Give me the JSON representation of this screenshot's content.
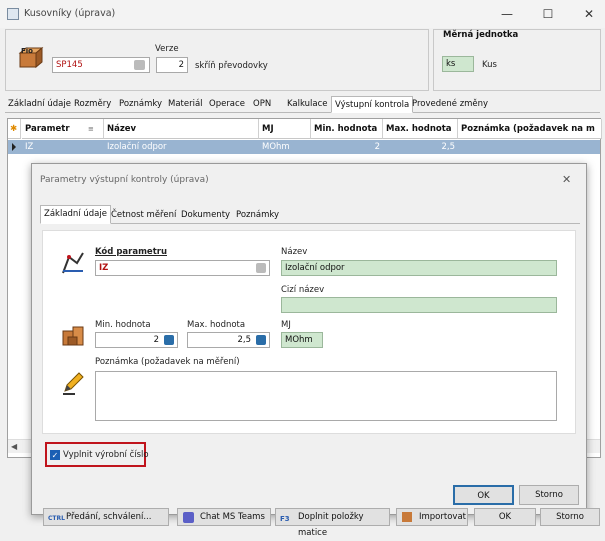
{
  "window": {
    "title": "Kusovníky (úprava)",
    "minimize": "—",
    "maximize": "☐",
    "close": "✕"
  },
  "header": {
    "verze_label": "Verze",
    "code_value": "SP145",
    "version_value": "2",
    "description": "skříň převodovky",
    "unit_group_title": "Měrná jednotka",
    "unit_code": "ks",
    "unit_name": "Kus"
  },
  "tabs": [
    "Základní údaje",
    "Rozměry",
    "Poznámky",
    "Materiál",
    "Operace",
    "OPN",
    "Kalkulace",
    "Výstupní kontrola",
    "Provedené změny"
  ],
  "grid": {
    "columns": [
      "Parametr",
      "Název",
      "MJ",
      "Min. hodnota",
      "Max. hodnota",
      "Poznámka (požadavek na m"
    ],
    "rows": [
      [
        "IZ",
        "Izolační odpor",
        "MOhm",
        "2",
        "2,5",
        ""
      ]
    ]
  },
  "dialog": {
    "title": "Parametry výstupní kontroly (úprava)",
    "close": "✕",
    "tabs": [
      "Základní údaje",
      "Četnost měření",
      "Dokumenty",
      "Poznámky"
    ],
    "kod_label": "Kód parametru",
    "kod_value": "IZ",
    "nazev_label": "Název",
    "nazev_value": "Izolační odpor",
    "cizi_label": "Cizí název",
    "cizi_value": "",
    "min_label": "Min. hodnota",
    "min_value": "2",
    "max_label": "Max. hodnota",
    "max_value": "2,5",
    "mj_label": "MJ",
    "mj_value": "MOhm",
    "poznamka_label": "Poznámka (požadavek na měření)",
    "poznamka_value": "",
    "checkbox_label": "Vyplnit výrobní číslo",
    "checkbox_checked": true,
    "ok": "OK",
    "storno": "Storno"
  },
  "bottom": {
    "b1": "Předání, schválení...",
    "b2": "Chat MS Teams",
    "b3": "Doplnit položky matice",
    "b4": "Importovat",
    "ok": "OK",
    "storno": "Storno"
  },
  "colors": {
    "accent": "#99b4d1",
    "highlight_border": "#c0141c",
    "field_green": "#cfe7cf"
  }
}
